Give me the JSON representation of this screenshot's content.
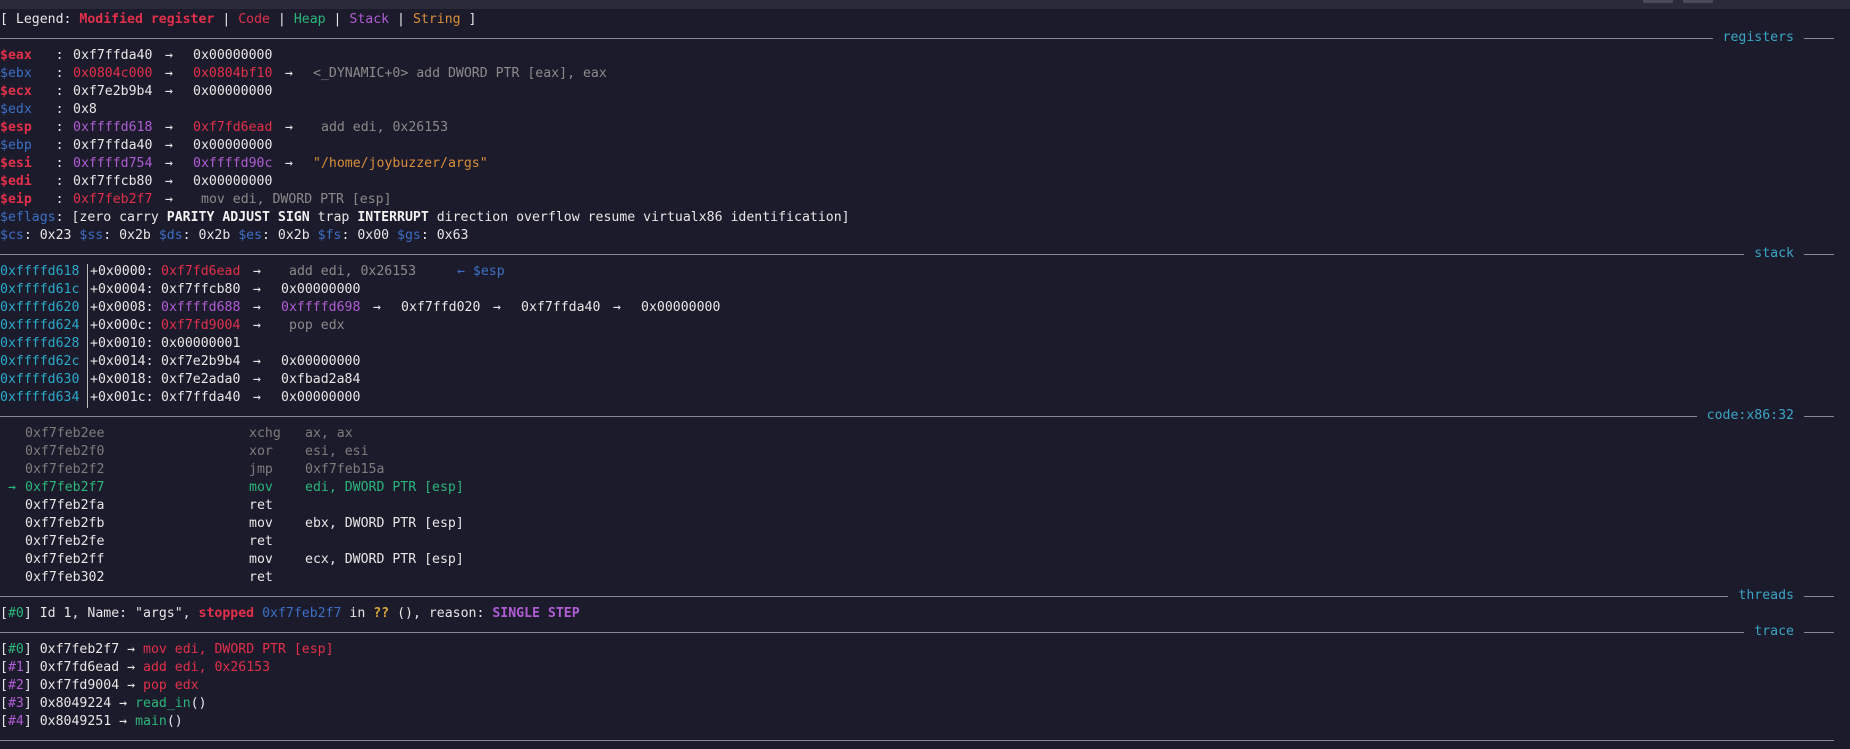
{
  "arrow": "→",
  "legend": {
    "open": "[ Legend: ",
    "modified": "Modified register",
    "sep": " | ",
    "code": "Code",
    "heap": "Heap",
    "stack": "Stack",
    "string": "String",
    "close": " ]"
  },
  "sections": {
    "registers": "registers",
    "stack": "stack",
    "code": "code:x86:32",
    "threads": "threads",
    "trace": "trace"
  },
  "registers": {
    "eax": {
      "name": "$eax",
      "pad": "   : ",
      "v1": "0xf7ffda40",
      "v2": "0x00000000"
    },
    "ebx": {
      "name": "$ebx",
      "pad": "   : ",
      "v1": "0x0804c000",
      "v2": "0x0804bf10",
      "v3": "<_DYNAMIC+0> add DWORD PTR [eax], eax"
    },
    "ecx": {
      "name": "$ecx",
      "pad": "   : ",
      "v1": "0xf7e2b9b4",
      "v2": "0x00000000"
    },
    "edx": {
      "name": "$edx",
      "pad": "   : ",
      "v1": "0x8"
    },
    "esp": {
      "name": "$esp",
      "pad": "   : ",
      "v1": "0xffffd618",
      "v2": "0xf7fd6ead",
      "v3": "add edi, 0x26153"
    },
    "ebp": {
      "name": "$ebp",
      "pad": "   : ",
      "v1": "0xf7ffda40",
      "v2": "0x00000000"
    },
    "esi": {
      "name": "$esi",
      "pad": "   : ",
      "v1": "0xffffd754",
      "v2": "0xffffd90c",
      "v3": "\"/home/joybuzzer/args\""
    },
    "edi": {
      "name": "$edi",
      "pad": "   : ",
      "v1": "0xf7ffcb80",
      "v2": "0x00000000"
    },
    "eip": {
      "name": "$eip",
      "pad": "   : ",
      "v1": "0xf7feb2f7",
      "v3": "mov edi, DWORD PTR [esp]"
    },
    "eflags": {
      "name": "$eflags",
      "pre": ": [",
      "f1": "zero carry ",
      "f2": "PARITY ADJUST SIGN",
      "f3": " trap ",
      "f4": "INTERRUPT",
      "f5": " direction overflow resume virtualx86 identification]"
    },
    "segs": [
      {
        "name": "$cs",
        "val": ": 0x23 "
      },
      {
        "name": "$ss",
        "val": ": 0x2b "
      },
      {
        "name": "$ds",
        "val": ": 0x2b "
      },
      {
        "name": "$es",
        "val": ": 0x2b "
      },
      {
        "name": "$fs",
        "val": ": 0x00 "
      },
      {
        "name": "$gs",
        "val": ": 0x63"
      }
    ]
  },
  "stack": [
    {
      "addr": "0xffffd618",
      "off": "+0x0000: ",
      "a": "0xf7fd6ead",
      "b": "add edi, 0x26153",
      "tag": "← $esp"
    },
    {
      "addr": "0xffffd61c",
      "off": "+0x0004: ",
      "a": "0xf7ffcb80",
      "b": "0x00000000"
    },
    {
      "addr": "0xffffd620",
      "off": "+0x0008: ",
      "a": "0xffffd688",
      "b": "0xffffd698",
      "c": "0xf7ffd020",
      "d": "0xf7ffda40",
      "e": "0x00000000"
    },
    {
      "addr": "0xffffd624",
      "off": "+0x000c: ",
      "a": "0xf7fd9004",
      "b": "pop edx"
    },
    {
      "addr": "0xffffd628",
      "off": "+0x0010: ",
      "a": "0x00000001"
    },
    {
      "addr": "0xffffd62c",
      "off": "+0x0014: ",
      "a": "0xf7e2b9b4",
      "b": "0x00000000"
    },
    {
      "addr": "0xffffd630",
      "off": "+0x0018: ",
      "a": "0xf7e2ada0",
      "b": "0xfbad2a84"
    },
    {
      "addr": "0xffffd634",
      "off": "+0x001c: ",
      "a": "0xf7ffda40",
      "b": "0x00000000"
    }
  ],
  "code": [
    {
      "addr": "0xf7feb2ee",
      "mn": "xchg",
      "op": "ax, ax"
    },
    {
      "addr": "0xf7feb2f0",
      "mn": "xor",
      "op": "esi, esi"
    },
    {
      "addr": "0xf7feb2f2",
      "mn": "jmp",
      "op": "0xf7feb15a"
    },
    {
      "addr": "0xf7feb2f7",
      "mn": "mov",
      "op": "edi, DWORD PTR [esp]"
    },
    {
      "addr": "0xf7feb2fa",
      "mn": "ret",
      "op": ""
    },
    {
      "addr": "0xf7feb2fb",
      "mn": "mov",
      "op": "ebx, DWORD PTR [esp]"
    },
    {
      "addr": "0xf7feb2fe",
      "mn": "ret",
      "op": ""
    },
    {
      "addr": "0xf7feb2ff",
      "mn": "mov",
      "op": "ecx, DWORD PTR [esp]"
    },
    {
      "addr": "0xf7feb302",
      "mn": "ret",
      "op": ""
    }
  ],
  "thread": {
    "idx": "#0",
    "p1": " Id 1, Name: \"args\", ",
    "stopped": "stopped",
    "addr": "0xf7feb2f7",
    "in": " in ",
    "qq": "??",
    "p2": " (), reason: ",
    "reason": "SINGLE STEP"
  },
  "trace": [
    {
      "idx": "#0",
      "addr": "0xf7feb2f7",
      "ins": "mov edi, DWORD PTR [esp]"
    },
    {
      "idx": "#1",
      "addr": "0xf7fd6ead",
      "ins": "add edi, 0x26153"
    },
    {
      "idx": "#2",
      "addr": "0xf7fd9004",
      "ins": "pop edx"
    },
    {
      "idx": "#3",
      "addr": "0x8049224",
      "fn": "read_in",
      "paren": "()"
    },
    {
      "idx": "#4",
      "addr": "0x8049251",
      "fn": "main",
      "paren": "()"
    }
  ]
}
